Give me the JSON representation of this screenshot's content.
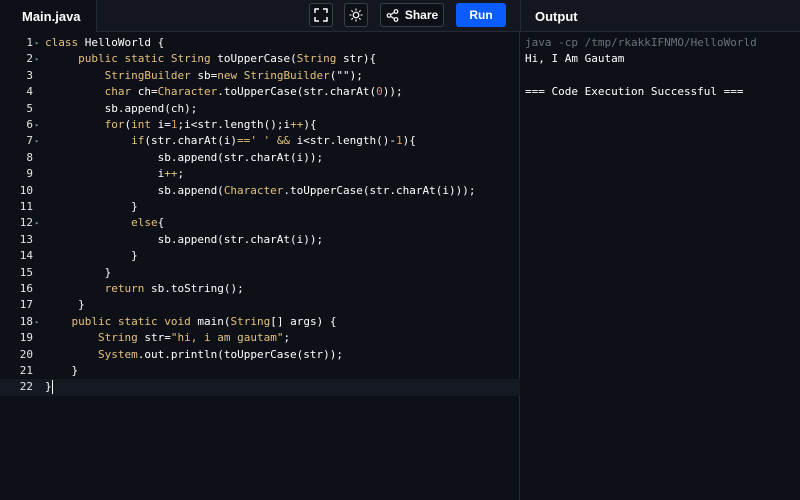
{
  "header": {
    "file_tab": "Main.java",
    "share_label": "Share",
    "run_label": "Run",
    "output_title": "Output",
    "icons": {
      "fullscreen": "fullscreen-icon",
      "theme": "sun-icon",
      "share": "share-icon"
    }
  },
  "colors": {
    "run_button": "#0a5cff",
    "background": "#0d1117",
    "keyword": "#e6c07b",
    "number": "#d19a66"
  },
  "editor": {
    "active_line": 22,
    "lines": [
      {
        "num": "1",
        "fold": true,
        "tokens": [
          [
            "k",
            "class"
          ],
          [
            "p",
            " HelloWorld {"
          ]
        ]
      },
      {
        "num": "2",
        "fold": true,
        "tokens": [
          [
            "p",
            "     "
          ],
          [
            "k",
            "public static"
          ],
          [
            "p",
            " "
          ],
          [
            "k",
            "String"
          ],
          [
            "p",
            " toUpperCase("
          ],
          [
            "k",
            "String"
          ],
          [
            "p",
            " str){"
          ]
        ]
      },
      {
        "num": "3",
        "fold": false,
        "tokens": [
          [
            "p",
            "         "
          ],
          [
            "k",
            "StringBuilder"
          ],
          [
            "p",
            " sb="
          ],
          [
            "k",
            "new"
          ],
          [
            "p",
            " "
          ],
          [
            "k",
            "StringBuilder"
          ],
          [
            "p",
            "(\"\");"
          ]
        ]
      },
      {
        "num": "4",
        "fold": false,
        "tokens": [
          [
            "p",
            "         "
          ],
          [
            "k",
            "char"
          ],
          [
            "p",
            " ch="
          ],
          [
            "k",
            "Character"
          ],
          [
            "p",
            ".toUpperCase(str.charAt("
          ],
          [
            "n",
            "0"
          ],
          [
            "p",
            "));"
          ]
        ]
      },
      {
        "num": "5",
        "fold": false,
        "tokens": [
          [
            "p",
            "         sb.append(ch);"
          ]
        ]
      },
      {
        "num": "6",
        "fold": true,
        "tokens": [
          [
            "p",
            "         "
          ],
          [
            "k",
            "for"
          ],
          [
            "p",
            "("
          ],
          [
            "k",
            "int"
          ],
          [
            "p",
            " i="
          ],
          [
            "n",
            "1"
          ],
          [
            "p",
            ";i<str.length();i"
          ],
          [
            "k",
            "++"
          ],
          [
            "p",
            "){"
          ]
        ]
      },
      {
        "num": "7",
        "fold": true,
        "tokens": [
          [
            "p",
            "             "
          ],
          [
            "k",
            "if"
          ],
          [
            "p",
            "(str.charAt(i)"
          ],
          [
            "k",
            "=="
          ],
          [
            "s",
            "' '"
          ],
          [
            "p",
            " "
          ],
          [
            "k",
            "&&"
          ],
          [
            "p",
            " i<str.length()-"
          ],
          [
            "n",
            "1"
          ],
          [
            "p",
            "){"
          ]
        ]
      },
      {
        "num": "8",
        "fold": false,
        "tokens": [
          [
            "p",
            "                 sb.append(str.charAt(i));"
          ]
        ]
      },
      {
        "num": "9",
        "fold": false,
        "tokens": [
          [
            "p",
            "                 i"
          ],
          [
            "k",
            "++"
          ],
          [
            "p",
            ";"
          ]
        ]
      },
      {
        "num": "10",
        "fold": false,
        "tokens": [
          [
            "p",
            "                 sb.append("
          ],
          [
            "k",
            "Character"
          ],
          [
            "p",
            ".toUpperCase(str.charAt(i)));"
          ]
        ]
      },
      {
        "num": "11",
        "fold": false,
        "tokens": [
          [
            "p",
            "             }"
          ]
        ]
      },
      {
        "num": "12",
        "fold": true,
        "tokens": [
          [
            "p",
            "             "
          ],
          [
            "k",
            "else"
          ],
          [
            "p",
            "{"
          ]
        ]
      },
      {
        "num": "13",
        "fold": false,
        "tokens": [
          [
            "p",
            "                 sb.append(str.charAt(i));"
          ]
        ]
      },
      {
        "num": "14",
        "fold": false,
        "tokens": [
          [
            "p",
            "             }"
          ]
        ]
      },
      {
        "num": "15",
        "fold": false,
        "tokens": [
          [
            "p",
            "         }"
          ]
        ]
      },
      {
        "num": "16",
        "fold": false,
        "tokens": [
          [
            "p",
            "         "
          ],
          [
            "k",
            "return"
          ],
          [
            "p",
            " sb.toString();"
          ]
        ]
      },
      {
        "num": "17",
        "fold": false,
        "tokens": [
          [
            "p",
            "     }"
          ]
        ]
      },
      {
        "num": "18",
        "fold": true,
        "tokens": [
          [
            "p",
            "    "
          ],
          [
            "k",
            "public static void"
          ],
          [
            "p",
            " main("
          ],
          [
            "k",
            "String"
          ],
          [
            "p",
            "[] args) {"
          ]
        ]
      },
      {
        "num": "19",
        "fold": false,
        "tokens": [
          [
            "p",
            "        "
          ],
          [
            "k",
            "String"
          ],
          [
            "p",
            " str="
          ],
          [
            "s",
            "\"hi, i am gautam\""
          ],
          [
            "p",
            ";"
          ]
        ]
      },
      {
        "num": "20",
        "fold": false,
        "tokens": [
          [
            "p",
            "        "
          ],
          [
            "k",
            "System"
          ],
          [
            "p",
            ".out.println(toUpperCase(str));"
          ]
        ]
      },
      {
        "num": "21",
        "fold": false,
        "tokens": [
          [
            "p",
            "    }"
          ]
        ]
      },
      {
        "num": "22",
        "fold": false,
        "tokens": [
          [
            "p",
            "}"
          ]
        ]
      }
    ]
  },
  "output": {
    "command": "java -cp /tmp/rkakkIFNMO/HelloWorld",
    "lines": [
      "Hi, I Am Gautam",
      "",
      "=== Code Execution Successful ==="
    ]
  }
}
